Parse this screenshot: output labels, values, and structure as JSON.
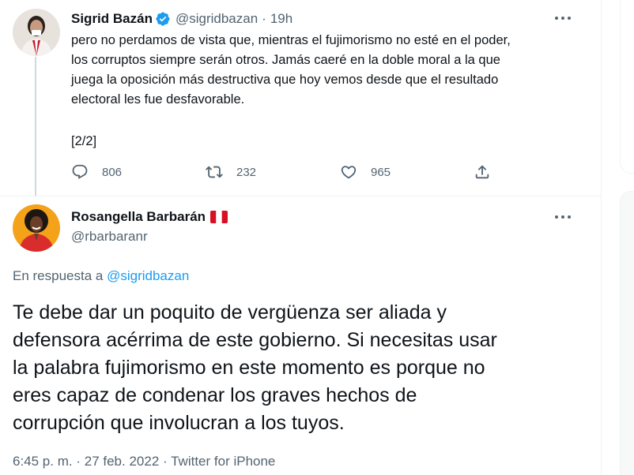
{
  "tweet1": {
    "name": "Sigrid Bazán",
    "handle": "@sigridbazan",
    "separator": "·",
    "time": "19h",
    "text_lines": [
      "pero no perdamos de vista que, mientras el fujimorismo no esté en el poder,",
      "los corruptos siempre serán otros. Jamás caeré en la doble moral a la que",
      "juega la oposición más destructiva que hoy vemos desde que el resultado",
      "electoral les fue desfavorable."
    ],
    "page_marker": "[2/2]",
    "replies": "806",
    "retweets": "232",
    "likes": "965",
    "icons": [
      "verified-badge-icon",
      "more-icon",
      "reply-icon",
      "retweet-icon",
      "like-icon",
      "share-icon"
    ]
  },
  "tweet2": {
    "name": "Rosangella Barbarán",
    "handle": "@rbarbaranr",
    "reply_prefix": "En respuesta a ",
    "reply_target": "@sigridbazan",
    "text_lines": [
      "Te debe dar un poquito de vergüenza ser  aliada y",
      "defensora acérrima de este gobierno. Si necesitas usar",
      "la palabra fujimorismo en este momento es porque no",
      "eres capaz de condenar los graves hechos de",
      "corrupción que involucran a los tuyos."
    ],
    "time": "6:45 p. m.",
    "separator1": "·",
    "date": "27 feb. 2022",
    "separator2": "·",
    "source": "Twitter for iPhone",
    "icons": [
      "peru-flag-icon",
      "more-icon"
    ]
  },
  "colors": {
    "accent": "#1d9bf0",
    "text": "#0f1419",
    "secondary": "#536471",
    "divider": "#eff3f4",
    "thread_line": "#cfd9de",
    "flag_red": "#d91023"
  }
}
